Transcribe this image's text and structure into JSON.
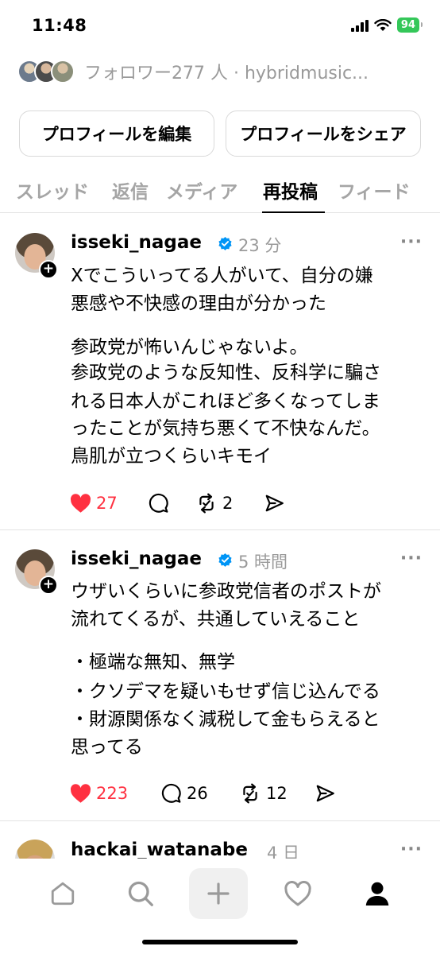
{
  "status_bar": {
    "time": "11:48",
    "battery": "94",
    "battery_color": "#34c759"
  },
  "profile": {
    "followers_text": "フォロワー277 人 · hybridmusic...",
    "edit_button": "プロフィールを編集",
    "share_button": "プロフィールをシェア"
  },
  "tabs": [
    {
      "label": "スレッド",
      "active": false
    },
    {
      "label": "返信",
      "active": false
    },
    {
      "label": "メディア",
      "active": false
    },
    {
      "label": "再投稿",
      "active": true
    },
    {
      "label": "フィード",
      "active": false
    }
  ],
  "posts": [
    {
      "username": "isseki_nagae",
      "verified": true,
      "time": "23 分",
      "lines": [
        "Xでこういってる人がいて、自分の嫌",
        "悪感や不快感の理由が分かった",
        "参政党が怖いんじゃないよ。",
        "参政党のような反知性、反科学に騙さ",
        "れる日本人がこれほど多くなってしま",
        "ったことが気持ち悪くて不快なんだ。",
        "鳥肌が立つくらいキモイ"
      ],
      "likes": "27",
      "replies": "",
      "reposts": "2"
    },
    {
      "username": "isseki_nagae",
      "verified": true,
      "time": "5 時間",
      "lines": [
        "ウザいくらいに参政党信者のポストが",
        "流れてくるが、共通していえること",
        "・極端な無知、無学",
        "・クソデマを疑いもせず信じ込んでる",
        "・財源関係なく減税して金もらえると",
        "思ってる"
      ],
      "likes": "223",
      "replies": "26",
      "reposts": "12"
    },
    {
      "username": "hackai_watanabe",
      "time": "4 日"
    }
  ],
  "colors": {
    "like": "#ff3040",
    "verified": "#0095f6",
    "muted": "#9a9a9a"
  },
  "icons": [
    "heart-icon",
    "comment-icon",
    "repost-icon",
    "share-icon",
    "home-icon",
    "search-icon",
    "create-icon",
    "activity-icon",
    "profile-icon"
  ]
}
